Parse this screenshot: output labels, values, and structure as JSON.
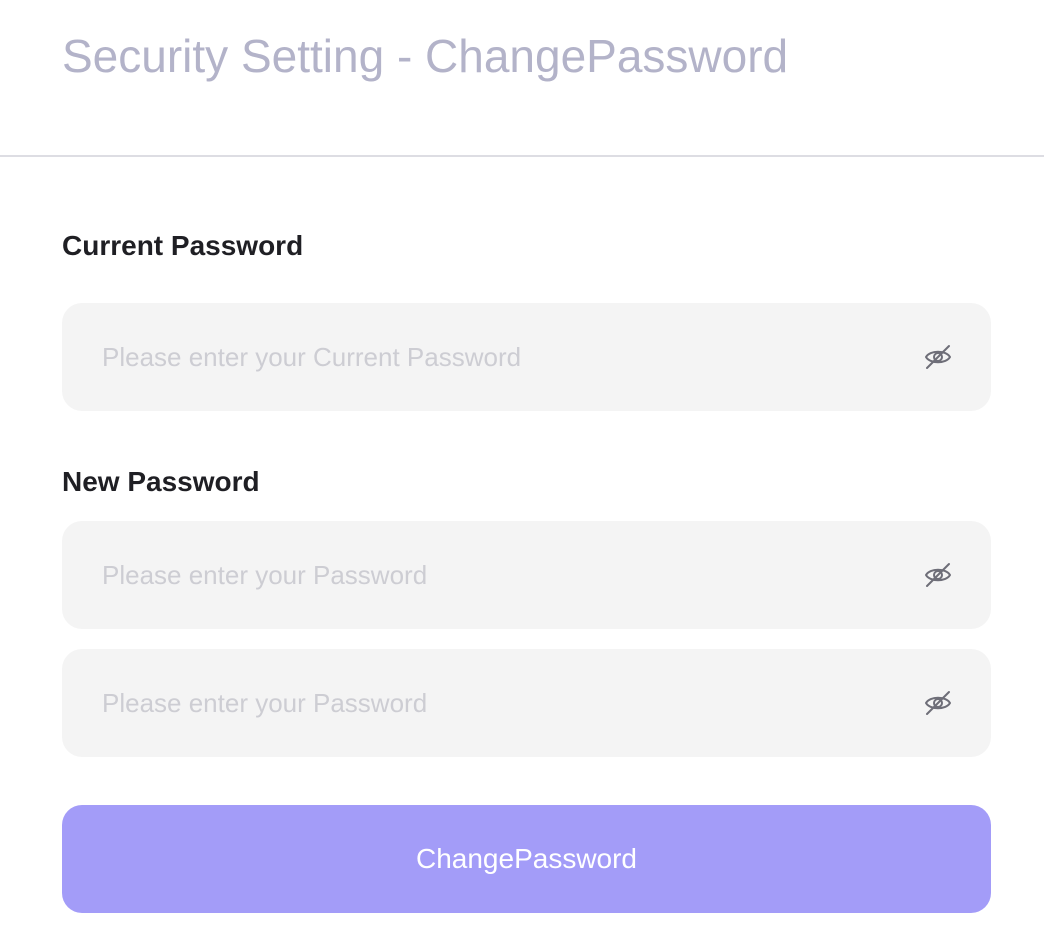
{
  "header": {
    "title": "Security Setting - ChangePassword"
  },
  "current_password": {
    "label": "Current Password",
    "value": "",
    "placeholder": "Please enter your Current Password",
    "toggle_icon": "eye-off-icon"
  },
  "new_password": {
    "label": "New Password",
    "value": "",
    "placeholder": "Please enter your Password",
    "toggle_icon": "eye-off-icon"
  },
  "confirm_password": {
    "value": "",
    "placeholder": "Please enter your Password",
    "toggle_icon": "eye-off-icon"
  },
  "submit": {
    "label": "ChangePassword"
  },
  "colors": {
    "title": "#b3b3c9",
    "label": "#1f1f24",
    "field_background": "#f4f4f4",
    "placeholder": "#cdcdd3",
    "icon": "#6e6e78",
    "button_background": "#a39cf8",
    "button_text": "#ffffff",
    "divider": "#dddde3"
  }
}
